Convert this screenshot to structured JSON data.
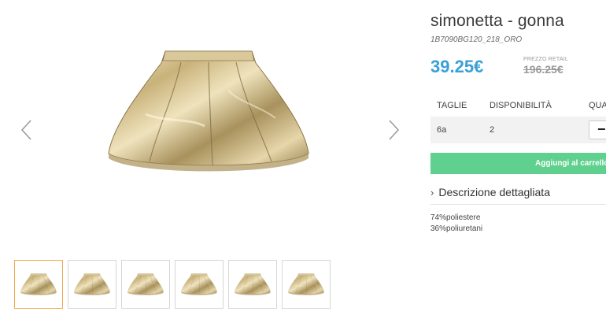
{
  "product": {
    "title": "simonetta - gonna",
    "sku": "1B7090BG120_218_ORO",
    "price": "39.25€",
    "retail_label": "PREZZO RETAIL",
    "retail_price": "196.25€"
  },
  "sizes": {
    "headers": [
      "TAGLIE",
      "DISPONIBILITÀ",
      "QUA"
    ],
    "rows": [
      {
        "size": "6a",
        "availability": "2",
        "qty_button": "−"
      }
    ]
  },
  "cart": {
    "add_label": "Aggiungi al carrello"
  },
  "description": {
    "header": "Descrizione dettagliata",
    "lines": [
      "74%poliestere",
      "36%poliuretani"
    ]
  },
  "gallery": {
    "thumbnail_count": 6,
    "active_thumbnail": 1,
    "icons": {
      "prev": "chevron-left-icon",
      "next": "chevron-right-icon",
      "collapse": "chevron-right-icon"
    }
  },
  "colors": {
    "price": "#3aa0d8",
    "add_button": "#5fd08d",
    "active_thumb_border": "#f1a54a",
    "row_background": "#f2f2f2"
  }
}
